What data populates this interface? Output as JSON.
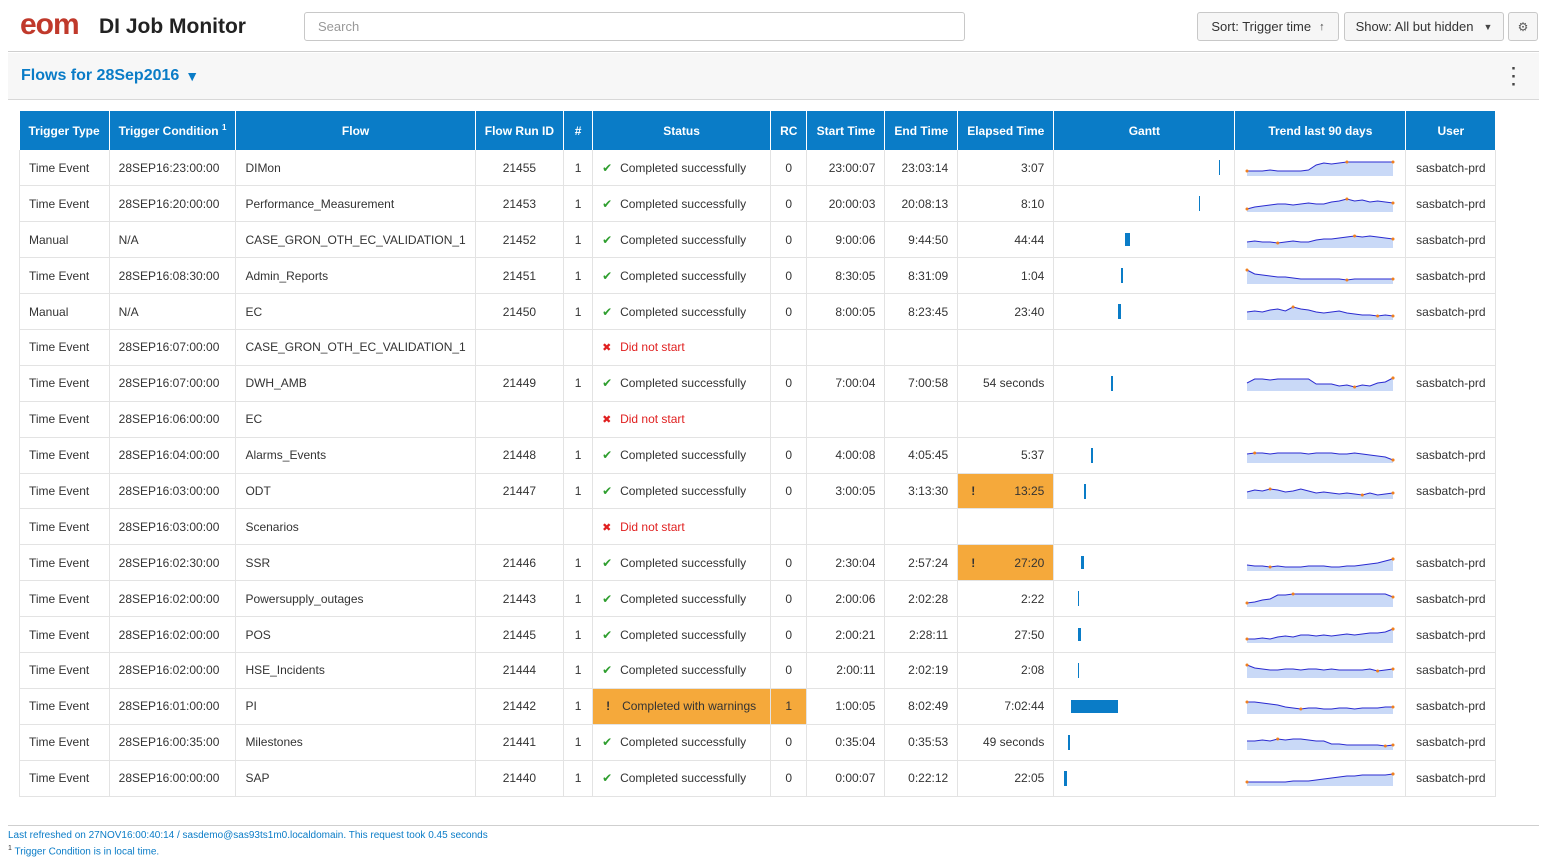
{
  "header": {
    "logo_text": "eom",
    "app_title": "DI Job Monitor",
    "search_placeholder": "Search",
    "sort_label": "Sort: Trigger time",
    "sort_icon": "arrow-up-icon",
    "show_label": "Show: All but hidden",
    "show_icon": "caret-down-icon",
    "settings_icon": "gear-icon"
  },
  "flows_bar": {
    "title": "Flows for 28Sep2016",
    "caret": "▼",
    "menu_icon": "kebab-icon"
  },
  "columns": {
    "trigger_type": "Trigger Type",
    "trigger_condition": "Trigger Condition",
    "trigger_condition_sup": "1",
    "flow": "Flow",
    "flow_run_id": "Flow Run ID",
    "num": "#",
    "status": "Status",
    "rc": "RC",
    "start_time": "Start Time",
    "end_time": "End Time",
    "elapsed_time": "Elapsed Time",
    "gantt": "Gantt",
    "trend": "Trend last 90 days",
    "user": "User"
  },
  "colors": {
    "accent": "#0a7cc7",
    "warning": "#f5a93b",
    "success": "#2e9e2e",
    "error": "#e02020",
    "logo": "#c0392b",
    "trend_line": "#2a2ad0",
    "trend_fill": "#c9d9f7",
    "trend_point": "#f08020"
  },
  "rows": [
    {
      "trigger_type": "Time Event",
      "trigger_condition": "28SEP16:23:00:00",
      "flow": "DIMon",
      "flow_run_id": "21455",
      "num": "1",
      "status": "Completed successfully",
      "status_kind": "success",
      "rc": "0",
      "start_time": "23:00:07",
      "end_time": "23:03:14",
      "elapsed": "3:07",
      "elapsed_warn": false,
      "user": "sasbatch-prd",
      "trend": [
        5,
        5,
        5,
        6,
        5,
        5,
        5,
        5,
        6,
        11,
        13,
        12,
        13,
        14,
        14,
        14,
        14,
        14,
        14,
        14
      ]
    },
    {
      "trigger_type": "Time Event",
      "trigger_condition": "28SEP16:20:00:00",
      "flow": "Performance_Measurement",
      "flow_run_id": "21453",
      "num": "1",
      "status": "Completed successfully",
      "status_kind": "success",
      "rc": "0",
      "start_time": "20:00:03",
      "end_time": "20:08:13",
      "elapsed": "8:10",
      "elapsed_warn": false,
      "user": "sasbatch-prd",
      "trend": [
        3,
        5,
        6,
        7,
        8,
        8,
        7,
        8,
        9,
        8,
        8,
        10,
        11,
        13,
        11,
        12,
        10,
        11,
        10,
        9
      ]
    },
    {
      "trigger_type": "Manual",
      "trigger_condition": "N/A",
      "flow": "CASE_GRON_OTH_EC_VALIDATION_1",
      "flow_run_id": "21452",
      "num": "1",
      "status": "Completed successfully",
      "status_kind": "success",
      "rc": "0",
      "start_time": "9:00:06",
      "end_time": "9:44:50",
      "elapsed": "44:44",
      "elapsed_warn": false,
      "user": "sasbatch-prd",
      "trend": [
        6,
        7,
        6,
        6,
        5,
        6,
        7,
        6,
        6,
        8,
        9,
        9,
        10,
        11,
        12,
        11,
        12,
        11,
        10,
        9
      ]
    },
    {
      "trigger_type": "Time Event",
      "trigger_condition": "28SEP16:08:30:00",
      "flow": "Admin_Reports",
      "flow_run_id": "21451",
      "num": "1",
      "status": "Completed successfully",
      "status_kind": "success",
      "rc": "0",
      "start_time": "8:30:05",
      "end_time": "8:31:09",
      "elapsed": "1:04",
      "elapsed_warn": false,
      "user": "sasbatch-prd",
      "trend": [
        14,
        10,
        9,
        8,
        7,
        7,
        6,
        5,
        5,
        5,
        5,
        5,
        5,
        4,
        5,
        5,
        5,
        5,
        5,
        5
      ]
    },
    {
      "trigger_type": "Manual",
      "trigger_condition": "N/A",
      "flow": "EC",
      "flow_run_id": "21450",
      "num": "1",
      "status": "Completed successfully",
      "status_kind": "success",
      "rc": "0",
      "start_time": "8:00:05",
      "end_time": "8:23:45",
      "elapsed": "23:40",
      "elapsed_warn": false,
      "user": "sasbatch-prd",
      "trend": [
        8,
        9,
        8,
        10,
        11,
        9,
        13,
        11,
        10,
        8,
        7,
        8,
        9,
        7,
        6,
        5,
        5,
        4,
        5,
        4
      ]
    },
    {
      "trigger_type": "Time Event",
      "trigger_condition": "28SEP16:07:00:00",
      "flow": "CASE_GRON_OTH_EC_VALIDATION_1",
      "flow_run_id": "",
      "num": "",
      "status": "Did not start",
      "status_kind": "fail",
      "rc": "",
      "start_time": "",
      "end_time": "",
      "elapsed": "",
      "elapsed_warn": false,
      "user": "",
      "trend": []
    },
    {
      "trigger_type": "Time Event",
      "trigger_condition": "28SEP16:07:00:00",
      "flow": "DWH_AMB",
      "flow_run_id": "21449",
      "num": "1",
      "status": "Completed successfully",
      "status_kind": "success",
      "rc": "0",
      "start_time": "7:00:04",
      "end_time": "7:00:58",
      "elapsed": "54 seconds",
      "elapsed_warn": false,
      "user": "sasbatch-prd",
      "trend": [
        8,
        12,
        12,
        11,
        12,
        12,
        12,
        12,
        12,
        7,
        7,
        7,
        5,
        6,
        4,
        6,
        5,
        8,
        9,
        13
      ]
    },
    {
      "trigger_type": "Time Event",
      "trigger_condition": "28SEP16:06:00:00",
      "flow": "EC",
      "flow_run_id": "",
      "num": "",
      "status": "Did not start",
      "status_kind": "fail",
      "rc": "",
      "start_time": "",
      "end_time": "",
      "elapsed": "",
      "elapsed_warn": false,
      "user": "",
      "trend": []
    },
    {
      "trigger_type": "Time Event",
      "trigger_condition": "28SEP16:04:00:00",
      "flow": "Alarms_Events",
      "flow_run_id": "21448",
      "num": "1",
      "status": "Completed successfully",
      "status_kind": "success",
      "rc": "0",
      "start_time": "4:00:08",
      "end_time": "4:05:45",
      "elapsed": "5:37",
      "elapsed_warn": false,
      "user": "sasbatch-prd",
      "trend": [
        9,
        10,
        10,
        9,
        10,
        10,
        10,
        10,
        9,
        10,
        10,
        10,
        9,
        9,
        10,
        9,
        8,
        7,
        6,
        3
      ]
    },
    {
      "trigger_type": "Time Event",
      "trigger_condition": "28SEP16:03:00:00",
      "flow": "ODT",
      "flow_run_id": "21447",
      "num": "1",
      "status": "Completed successfully",
      "status_kind": "success",
      "rc": "0",
      "start_time": "3:00:05",
      "end_time": "3:13:30",
      "elapsed": "13:25",
      "elapsed_warn": true,
      "user": "sasbatch-prd",
      "trend": [
        7,
        9,
        8,
        10,
        9,
        7,
        8,
        10,
        8,
        6,
        7,
        6,
        5,
        6,
        5,
        4,
        6,
        4,
        5,
        6
      ]
    },
    {
      "trigger_type": "Time Event",
      "trigger_condition": "28SEP16:03:00:00",
      "flow": "Scenarios",
      "flow_run_id": "",
      "num": "",
      "status": "Did not start",
      "status_kind": "fail",
      "rc": "",
      "start_time": "",
      "end_time": "",
      "elapsed": "",
      "elapsed_warn": false,
      "user": "",
      "trend": []
    },
    {
      "trigger_type": "Time Event",
      "trigger_condition": "28SEP16:02:30:00",
      "flow": "SSR",
      "flow_run_id": "21446",
      "num": "1",
      "status": "Completed successfully",
      "status_kind": "success",
      "rc": "0",
      "start_time": "2:30:04",
      "end_time": "2:57:24",
      "elapsed": "27:20",
      "elapsed_warn": true,
      "user": "sasbatch-prd",
      "trend": [
        6,
        5,
        5,
        4,
        5,
        4,
        4,
        4,
        5,
        5,
        5,
        4,
        4,
        5,
        5,
        6,
        7,
        8,
        10,
        12
      ]
    },
    {
      "trigger_type": "Time Event",
      "trigger_condition": "28SEP16:02:00:00",
      "flow": "Powersupply_outages",
      "flow_run_id": "21443",
      "num": "1",
      "status": "Completed successfully",
      "status_kind": "success",
      "rc": "0",
      "start_time": "2:00:06",
      "end_time": "2:02:28",
      "elapsed": "2:22",
      "elapsed_warn": false,
      "user": "sasbatch-prd",
      "trend": [
        4,
        5,
        7,
        8,
        12,
        12,
        13,
        13,
        13,
        13,
        13,
        13,
        13,
        13,
        13,
        13,
        13,
        13,
        13,
        10
      ]
    },
    {
      "trigger_type": "Time Event",
      "trigger_condition": "28SEP16:02:00:00",
      "flow": "POS",
      "flow_run_id": "21445",
      "num": "1",
      "status": "Completed successfully",
      "status_kind": "success",
      "rc": "0",
      "start_time": "2:00:21",
      "end_time": "2:28:11",
      "elapsed": "27:50",
      "elapsed_warn": false,
      "user": "sasbatch-prd",
      "trend": [
        4,
        4,
        5,
        4,
        6,
        7,
        6,
        8,
        8,
        7,
        8,
        7,
        8,
        9,
        8,
        9,
        10,
        10,
        11,
        14
      ]
    },
    {
      "trigger_type": "Time Event",
      "trigger_condition": "28SEP16:02:00:00",
      "flow": "HSE_Incidents",
      "flow_run_id": "21444",
      "num": "1",
      "status": "Completed successfully",
      "status_kind": "success",
      "rc": "0",
      "start_time": "2:00:11",
      "end_time": "2:02:19",
      "elapsed": "2:08",
      "elapsed_warn": false,
      "user": "sasbatch-prd",
      "trend": [
        13,
        10,
        9,
        8,
        8,
        9,
        9,
        8,
        9,
        9,
        8,
        9,
        8,
        8,
        8,
        8,
        9,
        7,
        8,
        9
      ]
    },
    {
      "trigger_type": "Time Event",
      "trigger_condition": "28SEP16:01:00:00",
      "flow": "PI",
      "flow_run_id": "21442",
      "num": "1",
      "status": "Completed with warnings",
      "status_kind": "warning",
      "rc": "1",
      "start_time": "1:00:05",
      "end_time": "8:02:49",
      "elapsed": "7:02:44",
      "elapsed_warn": false,
      "user": "sasbatch-prd",
      "trend": [
        12,
        12,
        11,
        10,
        9,
        7,
        6,
        5,
        6,
        6,
        5,
        5,
        6,
        6,
        5,
        6,
        6,
        6,
        7,
        7
      ]
    },
    {
      "trigger_type": "Time Event",
      "trigger_condition": "28SEP16:00:35:00",
      "flow": "Milestones",
      "flow_run_id": "21441",
      "num": "1",
      "status": "Completed successfully",
      "status_kind": "success",
      "rc": "0",
      "start_time": "0:35:04",
      "end_time": "0:35:53",
      "elapsed": "49 seconds",
      "elapsed_warn": false,
      "user": "sasbatch-prd",
      "trend": [
        9,
        9,
        10,
        9,
        11,
        10,
        11,
        11,
        10,
        9,
        9,
        6,
        6,
        5,
        5,
        5,
        5,
        5,
        4,
        5
      ]
    },
    {
      "trigger_type": "Time Event",
      "trigger_condition": "28SEP16:00:00:00",
      "flow": "SAP",
      "flow_run_id": "21440",
      "num": "1",
      "status": "Completed successfully",
      "status_kind": "success",
      "rc": "0",
      "start_time": "0:00:07",
      "end_time": "0:22:12",
      "elapsed": "22:05",
      "elapsed_warn": false,
      "user": "sasbatch-prd",
      "trend": [
        4,
        4,
        4,
        4,
        4,
        4,
        5,
        5,
        5,
        6,
        7,
        8,
        9,
        10,
        10,
        11,
        11,
        11,
        11,
        12
      ]
    }
  ],
  "footer": {
    "refresh_text": "Last refreshed on 27NOV16:00:40:14 / sasdemo@sas93ts1m0.localdomain. This request took 0.45 seconds",
    "note_sup": "1",
    "note_text": "Trigger Condition is in local time."
  }
}
